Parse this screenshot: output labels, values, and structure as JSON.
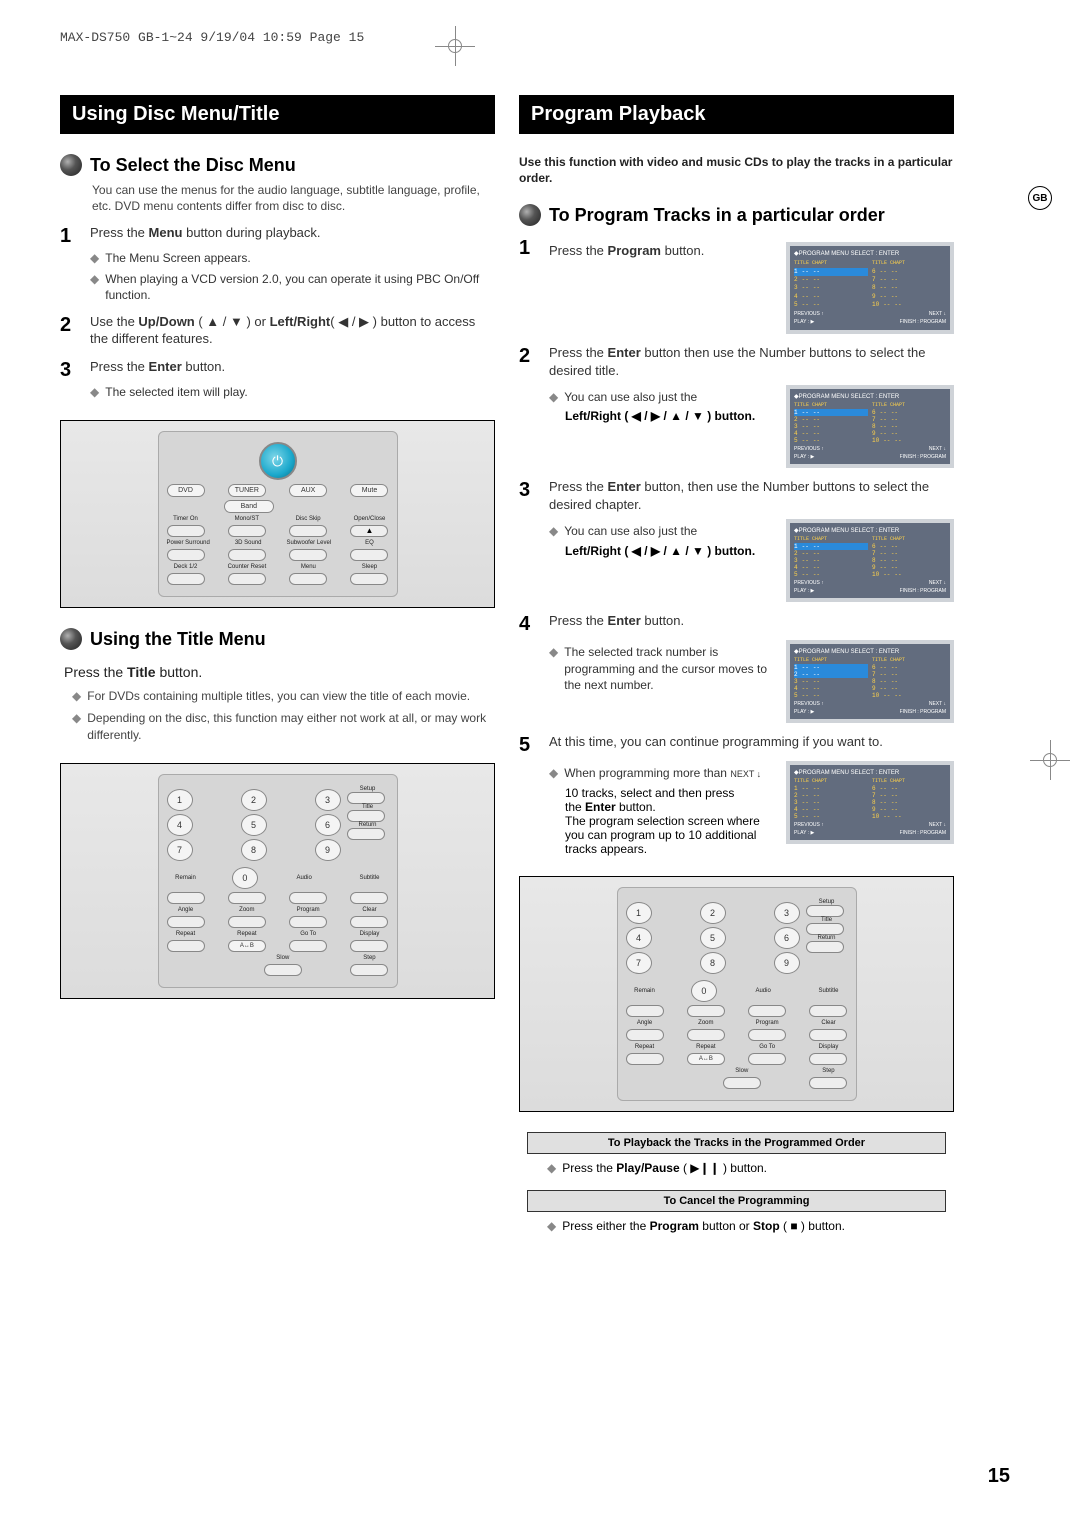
{
  "header": "MAX-DS750 GB-1~24   9/19/04 10:59  Page 15",
  "gb_badge": "GB",
  "page_number": "15",
  "left": {
    "bar": "Using Disc Menu/Title",
    "sect1": {
      "title": "To Select the Disc Menu",
      "intro": "You can use the menus for the audio language, subtitle language, profile, etc. DVD menu contents differ from disc to disc.",
      "step1": {
        "n": "1",
        "text1": "Press the ",
        "bold": "Menu",
        "text2": " button during playback."
      },
      "step1_sub1": "The Menu Screen appears.",
      "step1_sub2": "When playing a VCD version 2.0, you can operate it using PBC On/Off function.",
      "step2": {
        "n": "2",
        "text1": "Use the ",
        "bold1": "Up/Down",
        "mid": " ( ▲ / ▼ ) or ",
        "bold2": "Left/Right",
        "text2": "( ◀ / ▶ ) button to access the different features."
      },
      "step3": {
        "n": "3",
        "text1": "Press the ",
        "bold": "Enter",
        "text2": " button."
      },
      "step3_sub": "The selected item will play."
    },
    "sect2": {
      "title": "Using the Title Menu",
      "press": {
        "text1": "Press the ",
        "bold": "Title",
        "text2": " button."
      },
      "note1": "For DVDs containing multiple titles, you can view the title of each movie.",
      "note2": "Depending on the disc, this function may either not work at all, or may work differently."
    },
    "remote1": {
      "row1": [
        "DVD",
        "TUNER",
        "AUX",
        "Mute"
      ],
      "row1b": "Band",
      "row2_lbl": [
        "Timer On",
        "Mono/ST",
        "Disc Skip",
        "Open/Close"
      ],
      "row3_lbl": [
        "Power Surround",
        "3D Sound",
        "Subwoofer Level",
        "EQ"
      ],
      "row4_lbl": [
        "Deck 1/2",
        "Counter Reset",
        "Menu",
        "Sleep"
      ]
    },
    "remote2": {
      "nums": [
        "1",
        "2",
        "3",
        "4",
        "5",
        "6",
        "7",
        "8",
        "9",
        "0"
      ],
      "side": [
        "Setup",
        "Title",
        "Return"
      ],
      "row_a": [
        "Remain",
        "Audio",
        "Subtitle"
      ],
      "row_b": [
        "Angle",
        "Zoom",
        "Program",
        "Clear"
      ],
      "row_c": [
        "Repeat",
        "Repeat",
        "Go To",
        "Display"
      ],
      "row_c2": "A↔B",
      "row_d": [
        "Slow",
        "Step"
      ]
    }
  },
  "right": {
    "bar": "Program Playback",
    "intro": "Use this function with video and music CDs to play the tracks in a particular order.",
    "sect1": {
      "title": "To Program Tracks in a particular order",
      "step1": {
        "n": "1",
        "text1": "Press the ",
        "bold": "Program",
        "text2": " button."
      },
      "step2": {
        "n": "2",
        "text1": "Press the ",
        "bold": "Enter",
        "text2": " button then use the Number buttons to select the desired title."
      },
      "step2_sub": {
        "a": "You can use  also just the",
        "b": "Left/Right ( ◀ / ▶ / ▲ / ▼ ) button."
      },
      "step3": {
        "n": "3",
        "text1": "Press the ",
        "bold": "Enter",
        "text2": " button, then use the Number buttons to select the desired chapter."
      },
      "step3_sub": {
        "a": "You can use  also just the",
        "b": "Left/Right ( ◀ / ▶ / ▲ / ▼ ) button."
      },
      "step4": {
        "n": "4",
        "text1": "Press the ",
        "bold": "Enter",
        "text2": " button."
      },
      "step4_sub": "The selected track number is programming and the cursor moves to the next number.",
      "step5": {
        "n": "5",
        "text": "At this time, you can continue programming if you want to."
      },
      "step5_sub1a": "When programming more than",
      "step5_sub1b": "NEXT ↓",
      "step5_sub2": "10 tracks, select and then press",
      "step5_sub3a": "the ",
      "step5_sub3b": "Enter",
      "step5_sub3c": " button.",
      "step5_sub4": "The program selection screen where you can program up to 10 additional tracks appears."
    },
    "osd": {
      "hd": "◆PROGRAM MENU   SELECT : ENTER",
      "col_hd": "TITLE  CHAPT",
      "rows1": [
        [
          "1",
          "--",
          "--"
        ],
        [
          "2",
          "--",
          "--"
        ],
        [
          "3",
          "--",
          "--"
        ],
        [
          "4",
          "--",
          "--"
        ],
        [
          "5",
          "--",
          "--"
        ]
      ],
      "rows2": [
        [
          "6",
          "--",
          "--"
        ],
        [
          "7",
          "--",
          "--"
        ],
        [
          "8",
          "--",
          "--"
        ],
        [
          "9",
          "--",
          "--"
        ],
        [
          "10",
          "--",
          "--"
        ]
      ],
      "ftr_prev": "PREVIOUS ↑",
      "ftr_next": "NEXT ↓",
      "ftr_play": "PLAY : ▶",
      "ftr_fin": "FINISH : PROGRAM"
    },
    "subbox1": "To Playback the Tracks in the Programmed Order",
    "press1": {
      "a": "Press the ",
      "b": "Play/Pause",
      "c": " ( ▶❙❙ ) button."
    },
    "subbox2": "To Cancel the Programming",
    "press2": {
      "a": "Press either the ",
      "b": "Program",
      "c": " button or ",
      "d": "Stop",
      "e": " ( ■ ) button."
    }
  }
}
